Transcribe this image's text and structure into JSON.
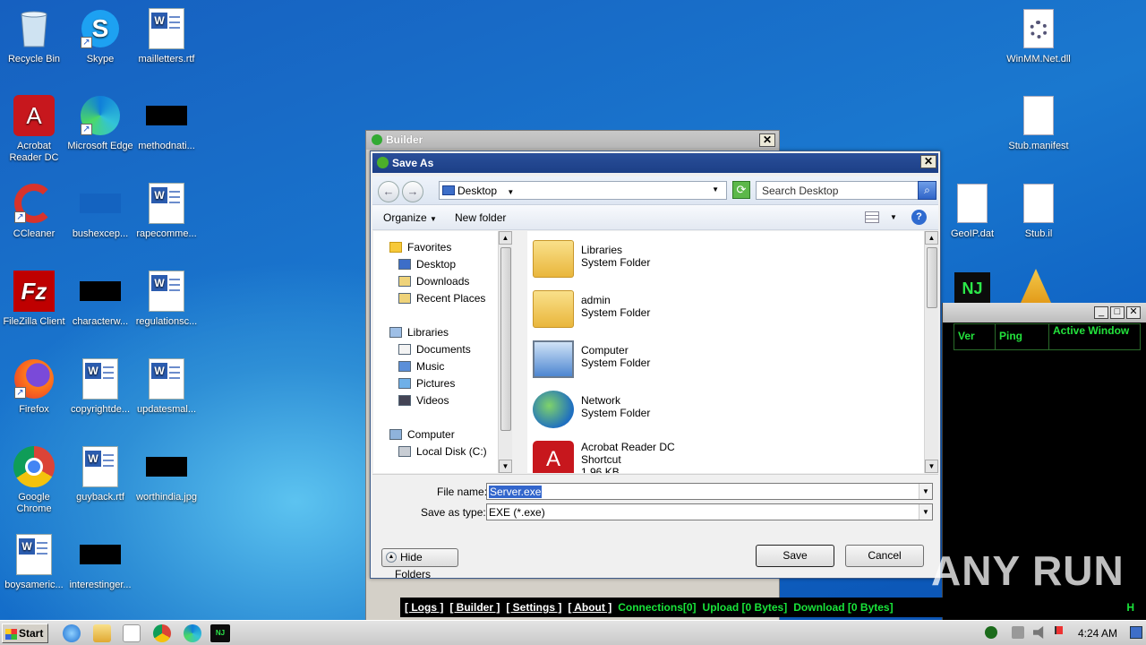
{
  "desktop_icons": [
    {
      "label": "Recycle Bin",
      "icon": "recycle-bin-icon"
    },
    {
      "label": "Skype",
      "icon": "skype-icon"
    },
    {
      "label": "mailletters.rtf",
      "icon": "word-document-icon"
    },
    {
      "label": "Acrobat Reader DC",
      "icon": "acrobat-icon"
    },
    {
      "label": "Microsoft Edge",
      "icon": "edge-icon"
    },
    {
      "label": "methodnati...",
      "icon": "redacted-file-icon"
    },
    {
      "label": "CCleaner",
      "icon": "ccleaner-icon"
    },
    {
      "label": "bushexcep...",
      "icon": "redacted-file-icon"
    },
    {
      "label": "rapecomme...",
      "icon": "word-document-icon"
    },
    {
      "label": "FileZilla Client",
      "icon": "filezilla-icon"
    },
    {
      "label": "characterw...",
      "icon": "redacted-file-icon"
    },
    {
      "label": "regulationsc...",
      "icon": "word-document-icon"
    },
    {
      "label": "Firefox",
      "icon": "firefox-icon"
    },
    {
      "label": "copyrightde...",
      "icon": "word-document-icon"
    },
    {
      "label": "updatesmal...",
      "icon": "word-document-icon"
    },
    {
      "label": "Google Chrome",
      "icon": "chrome-icon"
    },
    {
      "label": "guyback.rtf",
      "icon": "word-document-icon"
    },
    {
      "label": "worthindia.jpg",
      "icon": "redacted-file-icon"
    },
    {
      "label": "boysameric...",
      "icon": "word-document-icon"
    },
    {
      "label": "interestinger...",
      "icon": "redacted-file-icon"
    },
    {
      "label": "WinMM.Net.dll",
      "icon": "dll-file-icon"
    },
    {
      "label": "Stub.manifest",
      "icon": "blank-file-icon"
    },
    {
      "label": "GeoIP.dat",
      "icon": "blank-file-icon"
    },
    {
      "label": "Stub.il",
      "icon": "blank-file-icon"
    }
  ],
  "builder": {
    "title": "Builder"
  },
  "save_as": {
    "title": "Save As",
    "address": "Desktop",
    "search_placeholder": "Search Desktop",
    "toolbar": {
      "organize": "Organize",
      "new_folder": "New folder"
    },
    "tree": {
      "favorites": "Favorites",
      "desktop": "Desktop",
      "downloads": "Downloads",
      "recent": "Recent Places",
      "libraries": "Libraries",
      "documents": "Documents",
      "music": "Music",
      "pictures": "Pictures",
      "videos": "Videos",
      "computer": "Computer",
      "local_disk": "Local Disk (C:)"
    },
    "files": [
      {
        "name": "Libraries",
        "type": "System Folder"
      },
      {
        "name": "admin",
        "type": "System Folder"
      },
      {
        "name": "Computer",
        "type": "System Folder"
      },
      {
        "name": "Network",
        "type": "System Folder"
      },
      {
        "name": "Acrobat Reader DC",
        "type": "Shortcut",
        "size": "1.96 KB"
      }
    ],
    "file_name_label": "File name:",
    "file_name_value": "Server.exe",
    "save_type_label": "Save as type:",
    "save_type_value": "EXE (*.exe)",
    "hide_folders": "Hide Folders",
    "save": "Save",
    "cancel": "Cancel"
  },
  "njrat": {
    "columns": [
      "Ver",
      "Ping",
      "Active Window"
    ],
    "bottom": {
      "logs": "[ Logs ]",
      "builder": "[ Builder ]",
      "settings": "[ Settings ]",
      "about": "[ About ]",
      "connections": "Connections[0]",
      "upload": "Upload [0 Bytes]",
      "download": "Download [0 Bytes]",
      "right_label": "H"
    }
  },
  "taskbar": {
    "start": "Start",
    "clock": "4:24 AM"
  },
  "watermark": "ANY RUN"
}
